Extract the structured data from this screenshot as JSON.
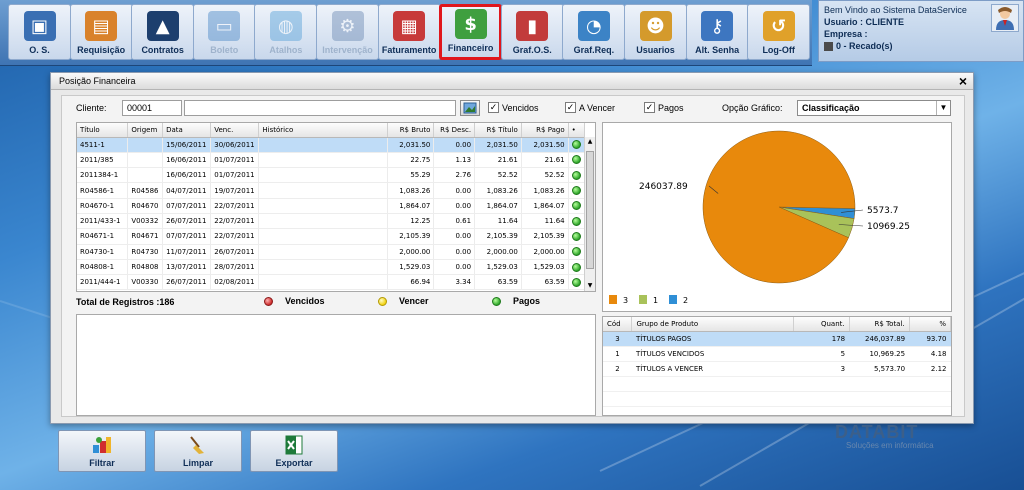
{
  "toolbar": {
    "buttons": [
      {
        "label": "O. S.",
        "icon": "computer-icon",
        "state": "normal"
      },
      {
        "label": "Requisição",
        "icon": "document-gear-icon",
        "state": "normal"
      },
      {
        "label": "Contratos",
        "icon": "contracts-icon",
        "state": "normal"
      },
      {
        "label": "Boleto",
        "icon": "monitor-icon",
        "state": "disabled"
      },
      {
        "label": "Atalhos",
        "icon": "globe-icon",
        "state": "disabled"
      },
      {
        "label": "Intervenção",
        "icon": "gears-icon",
        "state": "disabled"
      },
      {
        "label": "Faturamento",
        "icon": "invoice-icon",
        "state": "normal"
      },
      {
        "label": "Financeiro",
        "icon": "money-bag-icon",
        "state": "active"
      },
      {
        "label": "Graf.O.S.",
        "icon": "bar-chart-icon",
        "state": "normal"
      },
      {
        "label": "Graf.Req.",
        "icon": "pie-chart-icon",
        "state": "normal"
      },
      {
        "label": "Usuarios",
        "icon": "users-icon",
        "state": "normal"
      },
      {
        "label": "Alt. Senha",
        "icon": "key-icon",
        "state": "normal"
      },
      {
        "label": "Log-Off",
        "icon": "logoff-icon",
        "state": "normal"
      }
    ]
  },
  "welcome": {
    "line1": "Bem Vindo ao Sistema DataService",
    "line2": "Usuario : CLIENTE",
    "line3": "Empresa :",
    "line4": "0 - Recado(s)"
  },
  "window": {
    "title": "Posição Financeira",
    "close": "×"
  },
  "filters": {
    "cliente_label": "Cliente:",
    "cliente_code": "00001",
    "cliente_name": "",
    "vencidos_label": "Vencidos",
    "vencidos_checked": "✓",
    "avencer_label": "A Vencer",
    "avencer_checked": "✓",
    "pagos_label": "Pagos",
    "pagos_checked": "✓",
    "opcao_label": "Opção Gráfico:",
    "opcao_value": "Classificação"
  },
  "grid": {
    "headers": [
      "Título",
      "Origem",
      "Data",
      "Venc.",
      "Histórico",
      "R$ Bruto",
      "R$ Desc.",
      "R$ Título",
      "R$ Pago",
      "•"
    ],
    "rows": [
      [
        "4511-1",
        "",
        "15/06/2011",
        "30/06/2011",
        "",
        "2,031.50",
        "0.00",
        "2,031.50",
        "2,031.50"
      ],
      [
        "2011/385",
        "",
        "16/06/2011",
        "01/07/2011",
        "",
        "22.75",
        "1.13",
        "21.61",
        "21.61"
      ],
      [
        "2011384-1",
        "",
        "16/06/2011",
        "01/07/2011",
        "",
        "55.29",
        "2.76",
        "52.52",
        "52.52"
      ],
      [
        "R04586-1",
        "R04586",
        "04/07/2011",
        "19/07/2011",
        "",
        "1,083.26",
        "0.00",
        "1,083.26",
        "1,083.26"
      ],
      [
        "R04670-1",
        "R04670",
        "07/07/2011",
        "22/07/2011",
        "",
        "1,864.07",
        "0.00",
        "1,864.07",
        "1,864.07"
      ],
      [
        "2011/433-1",
        "V00332",
        "26/07/2011",
        "22/07/2011",
        "",
        "12.25",
        "0.61",
        "11.64",
        "11.64"
      ],
      [
        "R04671-1",
        "R04671",
        "07/07/2011",
        "22/07/2011",
        "",
        "2,105.39",
        "0.00",
        "2,105.39",
        "2,105.39"
      ],
      [
        "R04730-1",
        "R04730",
        "11/07/2011",
        "26/07/2011",
        "",
        "2,000.00",
        "0.00",
        "2,000.00",
        "2,000.00"
      ],
      [
        "R04808-1",
        "R04808",
        "13/07/2011",
        "28/07/2011",
        "",
        "1,529.03",
        "0.00",
        "1,529.03",
        "1,529.03"
      ],
      [
        "2011/444-1",
        "V00330",
        "26/07/2011",
        "02/08/2011",
        "",
        "66.94",
        "3.34",
        "63.59",
        "63.59"
      ]
    ]
  },
  "totals": {
    "label": "Total de Registros :186",
    "vencidos": "Vencidos",
    "vencer": "Vencer",
    "pagos": "Pagos"
  },
  "chart_data": {
    "type": "pie",
    "slices": [
      {
        "category": "3",
        "value": 246037.89,
        "label": "246037.89",
        "color": "#e8890c"
      },
      {
        "category": "1",
        "value": 10969.25,
        "label": "10969.25",
        "color": "#a9c25a"
      },
      {
        "category": "2",
        "value": 5573.7,
        "label": "5573.7",
        "color": "#2f8fd6"
      }
    ],
    "legend": [
      "3",
      "1",
      "2"
    ],
    "legend_position": "bottom-left"
  },
  "summary": {
    "headers": [
      "Cód",
      "Grupo de Produto",
      "Quant.",
      "R$ Total.",
      "%"
    ],
    "rows": [
      [
        "3",
        "TÍTULOS PAGOS",
        "178",
        "246,037.89",
        "93.70"
      ],
      [
        "1",
        "TÍTULOS VENCIDOS",
        "5",
        "10,969.25",
        "4.18"
      ],
      [
        "2",
        "TÍTULOS A VENCER",
        "3",
        "5,573.70",
        "2.12"
      ]
    ]
  },
  "bottom": {
    "filtrar": "Filtrar",
    "limpar": "Limpar",
    "exportar": "Exportar"
  },
  "brand": {
    "name": "DATABIT",
    "tagline": "Soluções em informática"
  }
}
